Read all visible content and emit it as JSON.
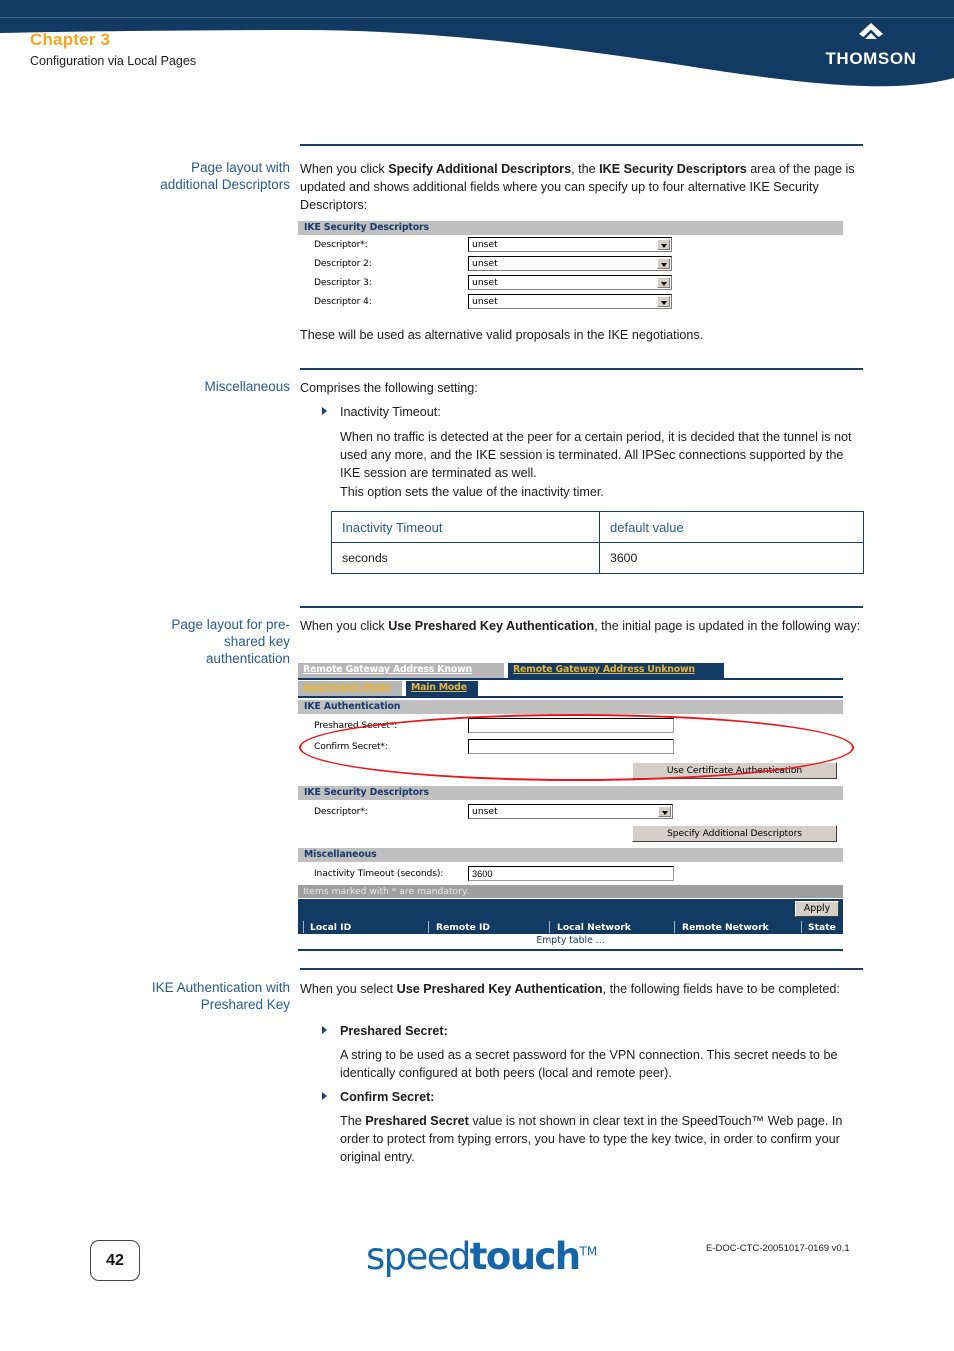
{
  "header": {
    "chapter": "Chapter 3",
    "subtitle": "Configuration via Local Pages",
    "brand": "THOMSON",
    "brand_mark": "thomson-diamond-icon",
    "band_color": "#123a63",
    "chapter_color": "#f5a623"
  },
  "sections": [
    {
      "label": "Page layout with\nadditional Descriptors",
      "label_line1": "Page layout with",
      "label_line2": "additional Descriptors",
      "intro_html": "When you click <b>Specify Additional Descriptors</b>, the <b>IKE Security Descriptors</b> area of the page is updated and shows additional fields where you can specify up to four alternative IKE Security Descriptors:",
      "after_html": "These will be used as alternative valid proposals in the IKE negotiations."
    },
    {
      "label_line1": "Miscellaneous",
      "intro_html": "Comprises the following setting:",
      "bullet": "Inactivity Timeout:",
      "paragraph": "When no traffic is detected at the peer for a certain period, it is decided that the tunnel is not used any more, and the IKE session is terminated. All IPSec connections supported by the IKE session are terminated as well.\nThis option sets the value of the inactivity timer."
    },
    {
      "label_line1": "Page layout for pre-",
      "label_line2": "shared key",
      "label_line3": "authentication",
      "intro_html": "When you click <b>Use Preshared Key Authentication</b>, the initial page is updated in the following way:"
    },
    {
      "label_line1": "IKE Authentication with",
      "label_line2": "Preshared Key",
      "intro_html": "When you select <b>Use Preshared Key Authentication</b>, the following fields have to be completed:",
      "bullet1": "Preshared Secret:",
      "para1": "A string to be used as a secret password for the VPN connection. This secret needs to be identically configured at both peers (local and remote peer).",
      "bullet2": "Confirm Secret:",
      "para2_html": "The <b>Preshared Secret</b> value is not shown in clear text in the SpeedTouch™ Web page. In order to protect from typing errors, you have to type the key twice, in order to confirm your original entry."
    }
  ],
  "timeout_table": {
    "columns": [
      "Inactivity Timeout",
      "default value"
    ],
    "rows": [
      [
        "seconds",
        "3600"
      ]
    ]
  },
  "screenshot_descriptors": {
    "section_title": "IKE Security Descriptors",
    "fields": [
      {
        "label": "Descriptor*:",
        "value": "unset"
      },
      {
        "label": "Descriptor 2:",
        "value": "unset"
      },
      {
        "label": "Descriptor 3:",
        "value": "unset"
      },
      {
        "label": "Descriptor 4:",
        "value": "unset"
      }
    ]
  },
  "screenshot_preshared": {
    "tabs_row1": [
      {
        "label": "Remote Gateway Address Known",
        "state": "active"
      },
      {
        "label": "Remote Gateway Address Unknown",
        "state": "inactive"
      }
    ],
    "tabs_row2": [
      {
        "label": "Aggressive Mode",
        "state": "inactive-gray"
      },
      {
        "label": "Main Mode",
        "state": "selected"
      }
    ],
    "auth_section_title": "IKE Authentication",
    "preshared_secret_label": "Preshared Secret*:",
    "preshared_secret_value": "",
    "confirm_secret_label": "Confirm Secret*:",
    "confirm_secret_value": "",
    "use_certificate_button": "Use Certificate Authentication",
    "descriptors_section_title": "IKE Security Descriptors",
    "descriptor_label": "Descriptor*:",
    "descriptor_value": "unset",
    "specify_additional_button": "Specify Additional Descriptors",
    "misc_section_title": "Miscellaneous",
    "inactivity_label": "Inactivity Timeout (seconds):",
    "inactivity_value": "3600",
    "mandatory_note": "Items marked with * are mandatory.",
    "apply_button": "Apply",
    "table_headers": [
      "Local ID",
      "Remote ID",
      "Local Network",
      "Remote Network",
      "State"
    ],
    "empty_table_text": "Empty table ...",
    "annotation_color": "#e8171b"
  },
  "footer": {
    "page_number": "42",
    "logo_light": "speed",
    "logo_bold": "touch",
    "logo_tm": "TM",
    "doc_code": "E-DOC-CTC-20051017-0169 v0.1"
  }
}
